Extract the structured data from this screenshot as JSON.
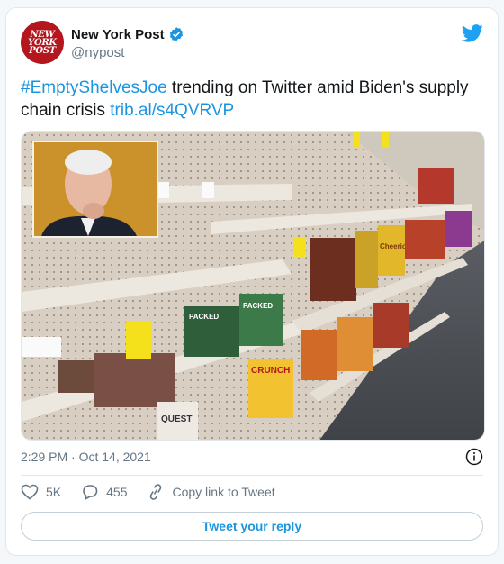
{
  "account": {
    "avatar_text": "NEW\nYORK\nPOST",
    "display_name": "New York Post",
    "handle": "@nypost",
    "verified_icon": "verified-badge-icon"
  },
  "tweet": {
    "hashtag": "#EmptyShelvesJoe",
    "body": " trending on Twitter amid Biden's supply chain crisis ",
    "link": "trib.al/s4QVRVP"
  },
  "media": {
    "shelf_labels": [
      "PACKED",
      "PACKED",
      "CRUNCH",
      "QUEST",
      "Cheerios"
    ]
  },
  "meta": {
    "timestamp": "2:29 PM · Oct 14, 2021"
  },
  "actions": {
    "likes": "5K",
    "replies": "455",
    "copy_link": "Copy link to Tweet",
    "reply_button": "Tweet your reply"
  },
  "colors": {
    "accent": "#1b95e0",
    "brand_red": "#b3161d",
    "muted": "#657786"
  }
}
